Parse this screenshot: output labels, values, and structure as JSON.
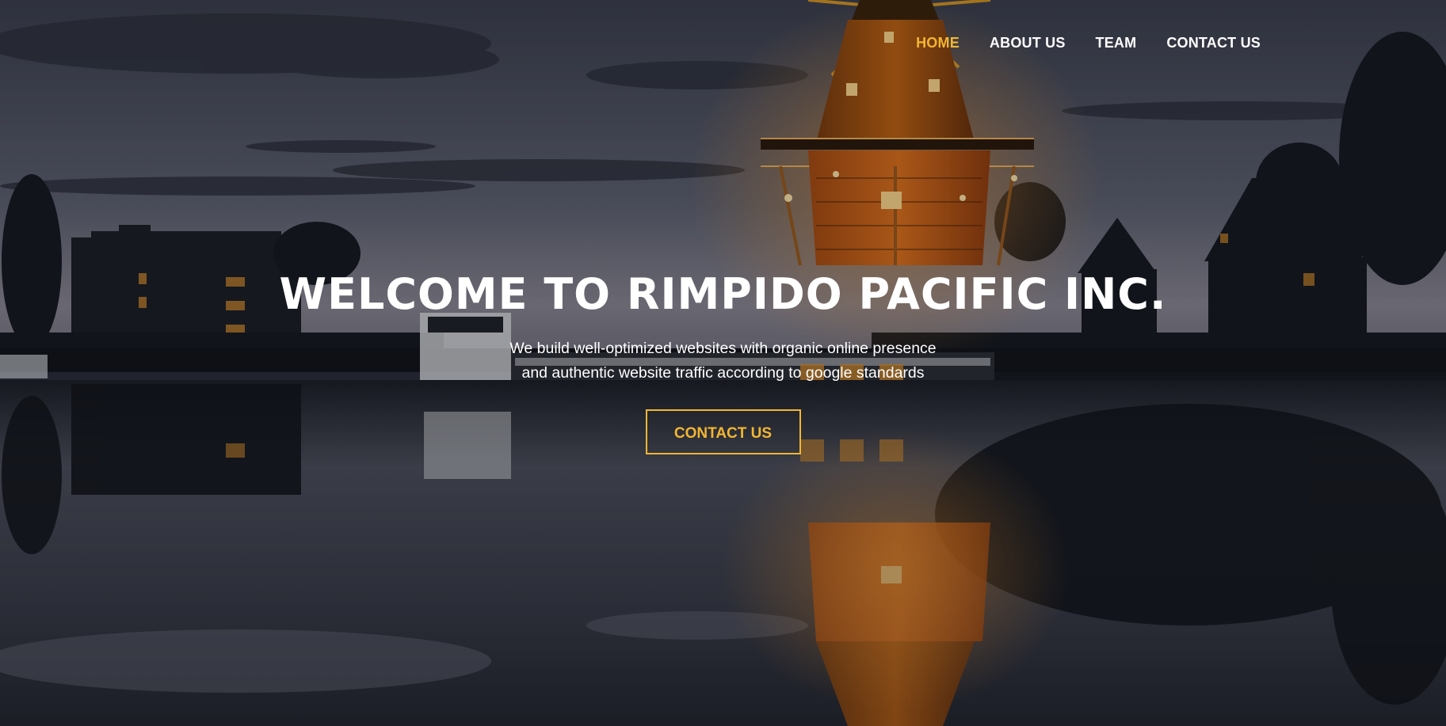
{
  "nav": {
    "items": [
      {
        "label": "HOME",
        "active": true
      },
      {
        "label": "ABOUT US",
        "active": false
      },
      {
        "label": "TEAM",
        "active": false
      },
      {
        "label": "CONTACT US",
        "active": false
      }
    ]
  },
  "hero": {
    "title": "WELCOME TO RIMPIDO PACIFIC INC.",
    "subtitle_line1": "We build well-optimized websites with organic online presence",
    "subtitle_line2": "and authentic website traffic according to google standards",
    "button_label": "CONTACT US"
  },
  "colors": {
    "accent": "#f2b632",
    "text": "#ffffff",
    "sky_top": "#3a3d4a",
    "sky_horizon": "#7c7f8c",
    "water": "#2a2d38"
  }
}
